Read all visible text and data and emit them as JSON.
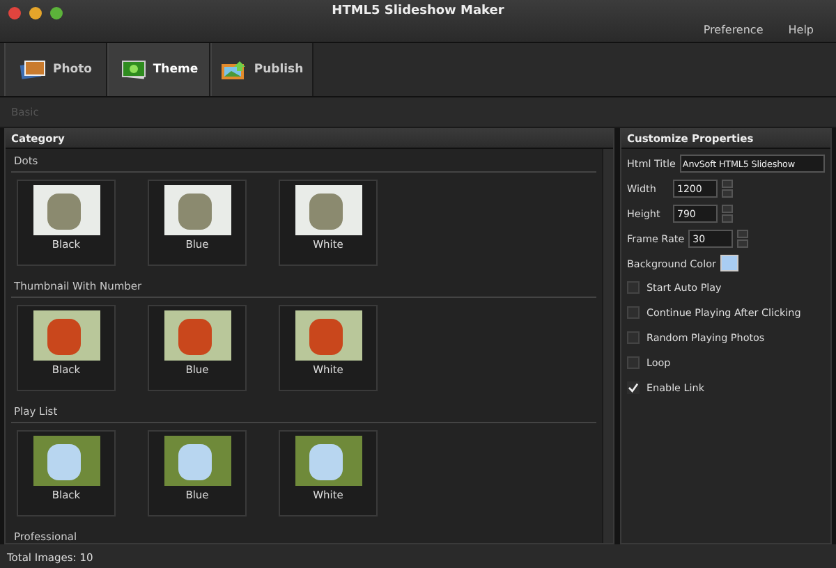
{
  "window": {
    "title": "HTML5 Slideshow Maker"
  },
  "menu": [
    "Preference",
    "Help"
  ],
  "tabs": [
    {
      "label": "Photo",
      "kind": "photo",
      "selected": false
    },
    {
      "label": "Theme",
      "kind": "theme",
      "selected": true
    },
    {
      "label": "Publish",
      "kind": "publish",
      "selected": false
    }
  ],
  "subnav": {
    "label": "Basic",
    "disabled": true
  },
  "category": {
    "title": "Category",
    "groups": [
      {
        "name": "Dots",
        "items": [
          {
            "label": "Black",
            "kind": "dots"
          },
          {
            "label": "Blue",
            "kind": "dots"
          },
          {
            "label": "White",
            "kind": "dots"
          }
        ]
      },
      {
        "name": "Thumbnail With Number",
        "items": [
          {
            "label": "Black",
            "kind": "thumbs"
          },
          {
            "label": "Blue",
            "kind": "thumbs"
          },
          {
            "label": "White",
            "kind": "thumbs"
          }
        ]
      },
      {
        "name": "Play List",
        "items": [
          {
            "label": "Black",
            "kind": "playlist"
          },
          {
            "label": "Blue",
            "kind": "playlist"
          },
          {
            "label": "White",
            "kind": "playlist"
          }
        ]
      },
      {
        "name": "Professional"
      }
    ]
  },
  "properties": {
    "title": "Customize Properties",
    "fields": [
      {
        "label": "Html Title",
        "kind": "text",
        "value": "AnvSoft HTML5 Slideshow"
      },
      {
        "label": "Width",
        "kind": "number",
        "value": "1200"
      },
      {
        "label": "Height",
        "kind": "number",
        "value": "790"
      },
      {
        "label": "Frame Rate",
        "kind": "number",
        "value": "30"
      },
      {
        "label": "Background Color",
        "kind": "color",
        "color": "#a9cdf2"
      }
    ],
    "options": [
      {
        "label": "Start Auto Play",
        "checked": false
      },
      {
        "label": "Continue Playing After Clicking",
        "checked": false
      },
      {
        "label": "Random Playing Photos",
        "checked": false
      },
      {
        "label": "Loop",
        "checked": false
      },
      {
        "label": "Enable Link",
        "checked": true
      }
    ]
  },
  "status_bar": {
    "text": "Total Images: 10"
  }
}
